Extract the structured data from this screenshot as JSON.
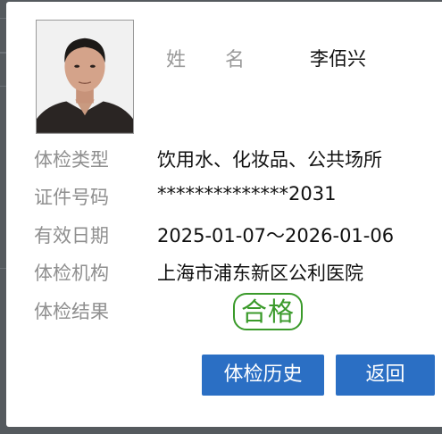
{
  "profile": {
    "name_label": "姓名",
    "name_value": "李佰兴"
  },
  "fields": [
    {
      "label": "体检类型",
      "value": "饮用水、化妆品、公共场所"
    },
    {
      "label": "证件号码",
      "value": "**************2031"
    },
    {
      "label": "有效日期",
      "value": "2025-01-07～2026-01-06"
    },
    {
      "label": "体检机构",
      "value": "上海市浦东新区公利医院"
    },
    {
      "label": "体检结果",
      "value": "合格"
    }
  ],
  "buttons": {
    "history": "体检历史",
    "back": "返回"
  },
  "colors": {
    "primary_button": "#2b6fc4",
    "pass_stamp": "#3a9a2a"
  }
}
